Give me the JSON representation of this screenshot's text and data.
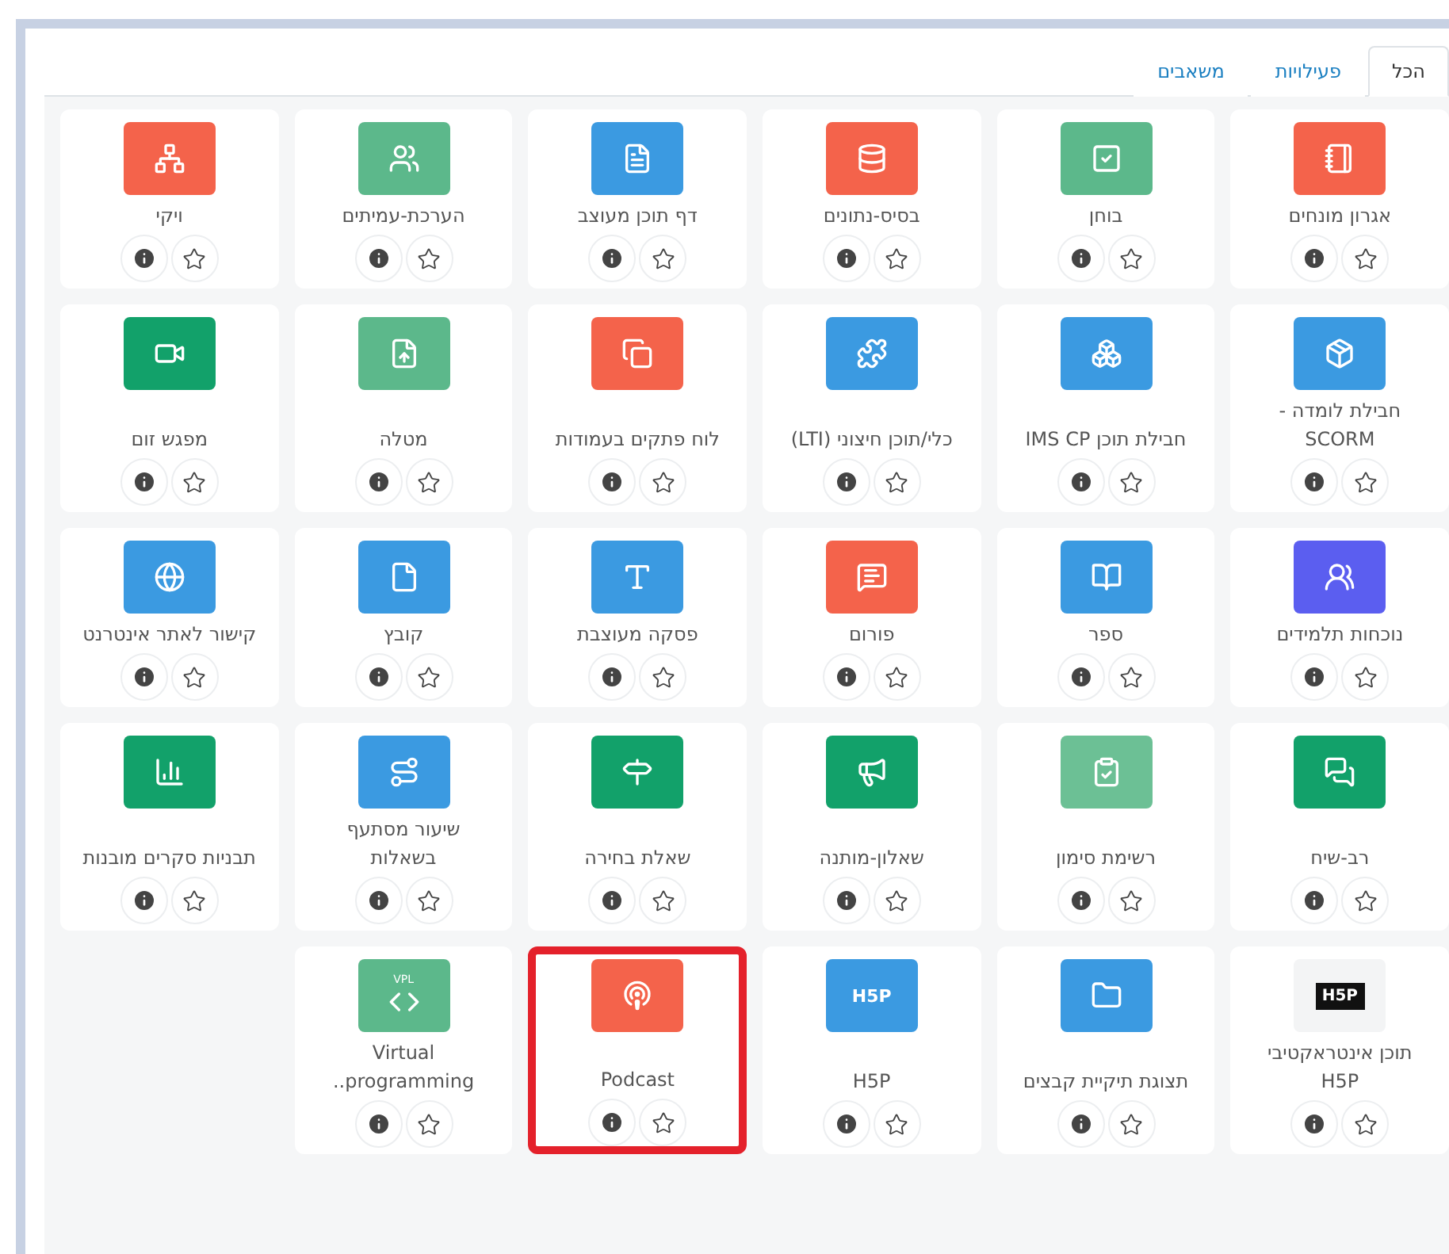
{
  "tabs": [
    {
      "label": "הכל",
      "selected": true
    },
    {
      "label": "פעילויות",
      "selected": false
    },
    {
      "label": "משאבים",
      "selected": false
    }
  ],
  "items": [
    {
      "label": "אגרון מונחים",
      "color": "#f4634b",
      "kind": "icon"
    },
    {
      "label": "בוחן",
      "color": "#5cb88b",
      "kind": "icon"
    },
    {
      "label": "בסיס-נתונים",
      "color": "#f4634b",
      "kind": "icon"
    },
    {
      "label": "דף תוכן מעוצב",
      "color": "#3b9ae1",
      "kind": "icon"
    },
    {
      "label": "הערכת-עמיתים",
      "color": "#5cb88b",
      "kind": "icon"
    },
    {
      "label": "ויקי",
      "color": "#f4634b",
      "kind": "icon"
    },
    {
      "label": "חבילת לומדה - SCORM",
      "color": "#3b9ae1",
      "kind": "icon"
    },
    {
      "label": "חבילת תוכן IMS CP",
      "color": "#3b9ae1",
      "kind": "icon"
    },
    {
      "label": "כלי/תוכן חיצוני (LTI)",
      "color": "#3b9ae1",
      "kind": "icon"
    },
    {
      "label": "לוח פתקים בעמודות",
      "color": "#f4634b",
      "kind": "icon"
    },
    {
      "label": "מטלה",
      "color": "#5cb88b",
      "kind": "icon"
    },
    {
      "label": "מפגש זום",
      "color": "#12a16a",
      "kind": "icon"
    },
    {
      "label": "נוכחות תלמידים",
      "color": "#5b5ef0",
      "kind": "icon"
    },
    {
      "label": "ספר",
      "color": "#3b9ae1",
      "kind": "icon"
    },
    {
      "label": "פורום",
      "color": "#f4634b",
      "kind": "icon"
    },
    {
      "label": "פסקה מעוצבת",
      "color": "#3b9ae1",
      "kind": "icon"
    },
    {
      "label": "קובץ",
      "color": "#3b9ae1",
      "kind": "icon"
    },
    {
      "label": "קישור לאתר אינטרנט",
      "color": "#3b9ae1",
      "kind": "icon"
    },
    {
      "label": "רב-שיח",
      "color": "#12a16a",
      "kind": "icon"
    },
    {
      "label": "רשימת סימון",
      "color": "#6cc095",
      "kind": "icon"
    },
    {
      "label": "שאלון-מותנה",
      "color": "#12a16a",
      "kind": "icon"
    },
    {
      "label": "שאלת בחירה",
      "color": "#12a16a",
      "kind": "icon"
    },
    {
      "label": "שיעור מסתעף בשאלות",
      "color": "#3b9ae1",
      "kind": "icon"
    },
    {
      "label": "תבניות סקרים מובנות",
      "color": "#12a16a",
      "kind": "icon"
    },
    {
      "label": "תוכן אינטראקטיבי H5P",
      "color": "#111111",
      "kind": "logo",
      "logo_text": "H5P"
    },
    {
      "label": "תצוגת תיקיית קבצים",
      "color": "#3b9ae1",
      "kind": "icon"
    },
    {
      "label": "H5P",
      "color": "#3b9ae1",
      "kind": "text",
      "logo_text": "H5P"
    },
    {
      "label": "Podcast",
      "color": "#f4634b",
      "kind": "icon",
      "highlighted": true
    },
    {
      "label": "Virtual programming..",
      "color": "#5cb88b",
      "kind": "icon",
      "logo_text": "VPL"
    }
  ]
}
